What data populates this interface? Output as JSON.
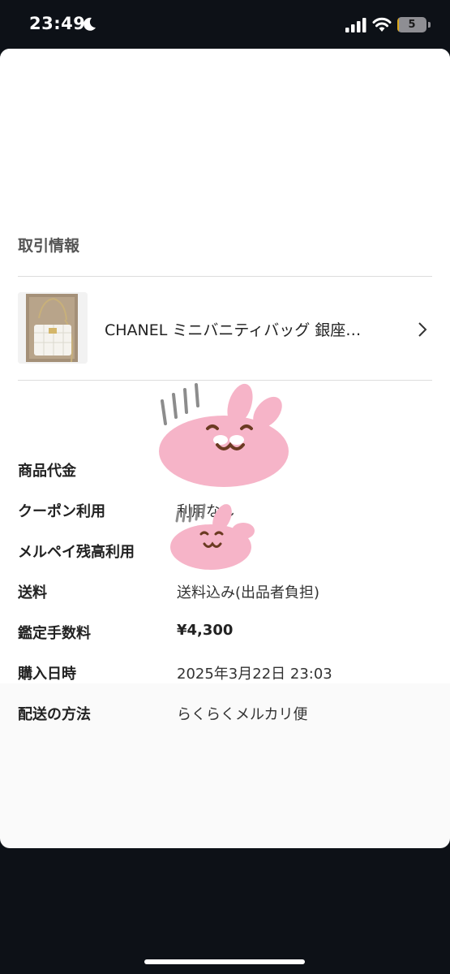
{
  "status_bar": {
    "time": "23:49",
    "battery_level": "5",
    "battery_fraction": 0.05,
    "icons": [
      "moon-icon",
      "signal-icon",
      "wifi-icon",
      "battery-icon"
    ]
  },
  "transaction": {
    "section_title": "取引情報",
    "product": {
      "title": "CHANEL ミニバニティバッグ 銀座…"
    },
    "rows": [
      {
        "label": "商品代金",
        "value": ""
      },
      {
        "label": "クーポン利用",
        "value": "利用なし"
      },
      {
        "label": "メルペイ残高利用",
        "value": ""
      },
      {
        "label": "送料",
        "value": "送料込み(出品者負担)"
      },
      {
        "label": "鑑定手数料",
        "value": "¥4,300"
      },
      {
        "label": "購入日時",
        "value": "2025年3月22日 23:03"
      },
      {
        "label": "配送の方法",
        "value": "らくらくメルカリ便"
      }
    ]
  },
  "colors": {
    "background": "#0d1117",
    "sheet": "#ffffff",
    "divider": "#dddddd",
    "sticker_pink": "#f6b4c8"
  }
}
